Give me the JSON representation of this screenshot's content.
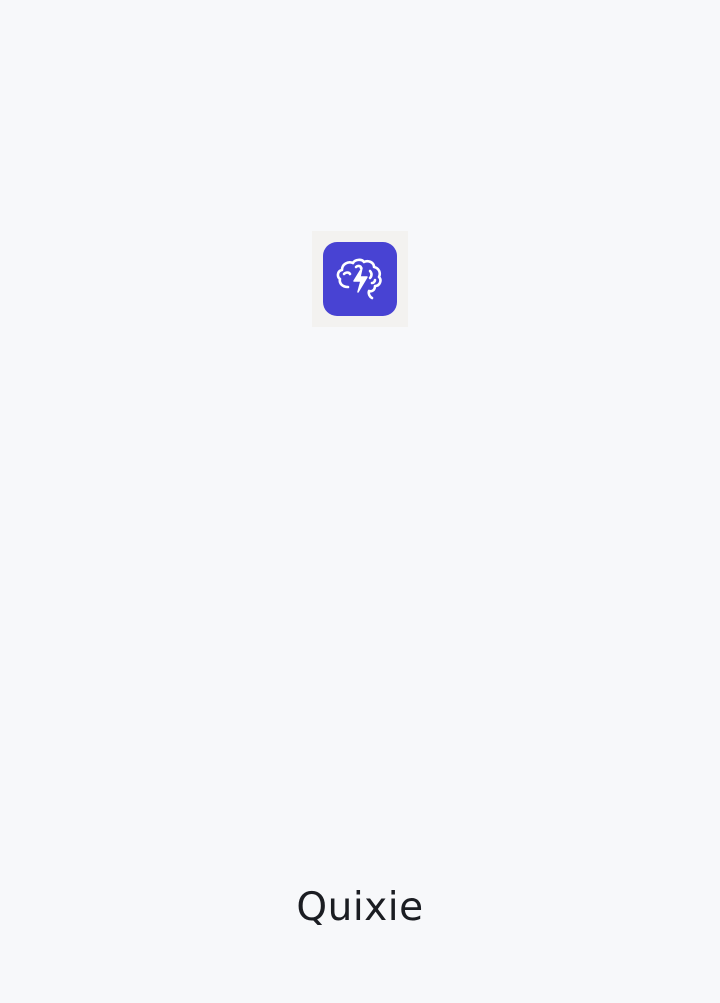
{
  "splash": {
    "app_name": "Quixie",
    "logo": {
      "icon": "brain-lightning-icon",
      "tile_color": "#4843d3"
    }
  },
  "colors": {
    "background": "#f7f8fa",
    "text": "#1b1d22"
  }
}
